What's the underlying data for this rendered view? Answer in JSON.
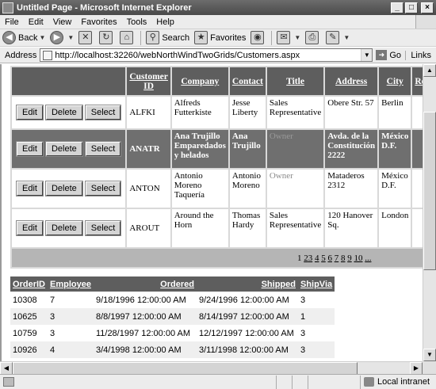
{
  "window": {
    "title": "Untitled Page - Microsoft Internet Explorer",
    "min": "_",
    "max": "□",
    "close": "×"
  },
  "menu": [
    "File",
    "Edit",
    "View",
    "Favorites",
    "Tools",
    "Help"
  ],
  "toolbar": {
    "back": "Back",
    "search": "Search",
    "favorites": "Favorites"
  },
  "address": {
    "label": "Address",
    "url": "http://localhost:32260/webNorthWindTwoGrids/Customers.aspx",
    "go": "Go",
    "links": "Links"
  },
  "customers": {
    "columns": [
      "Customer ID",
      "Company",
      "Contact",
      "Title",
      "Address",
      "City",
      "Regio"
    ],
    "actions": {
      "edit": "Edit",
      "delete": "Delete",
      "select": "Select"
    },
    "rows": [
      {
        "id": "ALFKI",
        "company": "Alfreds Futterkiste",
        "contact": "Jesse Liberty",
        "title": "Sales Representative",
        "address": "Obere Str. 57",
        "city": "Berlin"
      },
      {
        "id": "ANATR",
        "company": "Ana Trujillo Emparedados y helados",
        "contact": "Ana Trujillo",
        "title": "Owner",
        "address": "Avda. de la Constitución 2222",
        "city": "México D.F."
      },
      {
        "id": "ANTON",
        "company": "Antonio Moreno Taquería",
        "contact": "Antonio Moreno",
        "title": "Owner",
        "address": "Mataderos 2312",
        "city": "México D.F."
      },
      {
        "id": "AROUT",
        "company": "Around the Horn",
        "contact": "Thomas Hardy",
        "title": "Sales Representative",
        "address": "120 Hanover Sq.",
        "city": "London"
      }
    ],
    "pager": [
      "1",
      "2",
      "3",
      "4",
      "5",
      "6",
      "7",
      "8",
      "9",
      "10",
      "..."
    ]
  },
  "orders": {
    "columns": [
      "OrderID",
      "Employee",
      "Ordered",
      "Shipped",
      "ShipVia"
    ],
    "rows": [
      {
        "id": "10308",
        "employee": "7",
        "ordered": "9/18/1996 12:00:00 AM",
        "shipped": "9/24/1996 12:00:00 AM",
        "shipvia": "3"
      },
      {
        "id": "10625",
        "employee": "3",
        "ordered": "8/8/1997 12:00:00 AM",
        "shipped": "8/14/1997 12:00:00 AM",
        "shipvia": "1"
      },
      {
        "id": "10759",
        "employee": "3",
        "ordered": "11/28/1997 12:00:00 AM",
        "shipped": "12/12/1997 12:00:00 AM",
        "shipvia": "3"
      },
      {
        "id": "10926",
        "employee": "4",
        "ordered": "3/4/1998 12:00:00 AM",
        "shipped": "3/11/1998 12:00:00 AM",
        "shipvia": "3"
      }
    ]
  },
  "status": {
    "zone": "Local intranet"
  }
}
